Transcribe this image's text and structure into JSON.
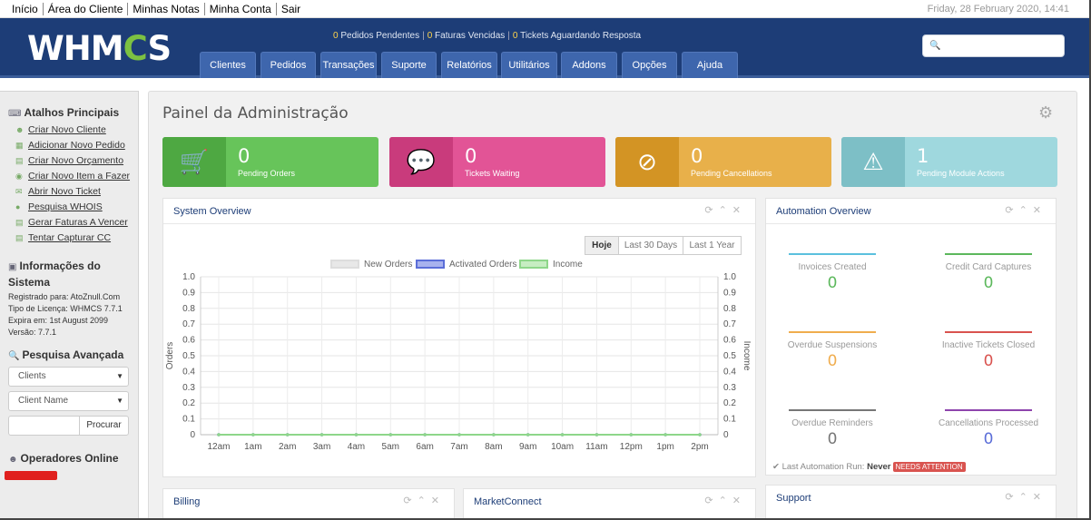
{
  "topbar": {
    "links": [
      "Início",
      "Área do Cliente",
      "Minhas Notas",
      "Minha Conta",
      "Sair"
    ],
    "date": "Friday, 28 February 2020, 14:41"
  },
  "header": {
    "logo_text": "WHMCS",
    "stats": [
      {
        "count": "0",
        "label": "Pedidos Pendentes"
      },
      {
        "count": "0",
        "label": "Faturas Vencidas"
      },
      {
        "count": "0",
        "label": "Tickets Aguardando Resposta"
      }
    ],
    "search": {
      "placeholder": "",
      "icon": "search-icon"
    },
    "nav": [
      "Clientes",
      "Pedidos",
      "Transações",
      "Suporte",
      "Relatórios",
      "Utilitários",
      "Addons",
      "Opções",
      "Ajuda"
    ]
  },
  "sidebar": {
    "shortcuts": {
      "title": "Atalhos Principais",
      "items": [
        {
          "label": "Criar Novo Cliente",
          "icon": "add-user-icon"
        },
        {
          "label": "Adicionar Novo Pedido",
          "icon": "add-order-icon"
        },
        {
          "label": "Criar Novo Orçamento",
          "icon": "quote-icon"
        },
        {
          "label": "Criar Novo Item a Fazer",
          "icon": "todo-icon"
        },
        {
          "label": "Abrir Novo Ticket",
          "icon": "ticket-icon"
        },
        {
          "label": "Pesquisa WHOIS",
          "icon": "globe-icon"
        },
        {
          "label": "Gerar Faturas A Vencer",
          "icon": "invoice-icon"
        },
        {
          "label": "Tentar Capturar CC",
          "icon": "credit-card-icon"
        }
      ]
    },
    "system_info": {
      "title": "Informações do Sistema",
      "lines": [
        "Registrado para: AtoZnull.Com",
        "Tipo de Licença: WHMCS 7.7.1",
        "Expira em: 1st August 2099",
        "Versão: 7.7.1"
      ]
    },
    "advanced_search": {
      "title": "Pesquisa Avançada",
      "type_select": "Clients",
      "field_select": "Client Name",
      "input_value": "",
      "button": "Procurar"
    },
    "operators": {
      "title": "Operadores Online"
    }
  },
  "main": {
    "title": "Painel da Administração",
    "tiles": [
      {
        "value": "0",
        "label": "Pending Orders",
        "icon": "cart-icon",
        "color": "#5cb85c"
      },
      {
        "value": "0",
        "label": "Tickets Waiting",
        "icon": "chat-bubble-icon",
        "color": "#de4d8c"
      },
      {
        "value": "0",
        "label": "Pending Cancellations",
        "icon": "ban-icon",
        "color": "#eaa73b"
      },
      {
        "value": "1",
        "label": "Pending Module Actions",
        "icon": "warning-icon",
        "color": "#8fd3d9"
      }
    ],
    "system_overview": {
      "title": "System Overview",
      "ranges": [
        "Hoje",
        "Last 30 Days",
        "Last 1 Year"
      ],
      "active_range": "Hoje"
    },
    "automation": {
      "title": "Automation Overview",
      "items": [
        {
          "label": "Invoices Created",
          "value": "0",
          "color": "#5bc0de"
        },
        {
          "label": "Credit Card Captures",
          "value": "0",
          "color": "#5cb85c"
        },
        {
          "label": "Overdue Suspensions",
          "value": "0",
          "color": "#f0ad4e"
        },
        {
          "label": "Inactive Tickets Closed",
          "value": "0",
          "color": "#d9534f"
        },
        {
          "label": "Overdue Reminders",
          "value": "0",
          "color": "#777777"
        },
        {
          "label": "Cancellations Processed",
          "value": "0",
          "color": "#8e44ad"
        }
      ],
      "last_run_label": "Last Automation Run:",
      "last_run_value": "Never",
      "badge": "NEEDS ATTENTION"
    },
    "billing": {
      "title": "Billing"
    },
    "marketconnect": {
      "title": "MarketConnect"
    },
    "support": {
      "title": "Support"
    }
  },
  "chart_data": {
    "type": "line",
    "x": [
      "12am",
      "1am",
      "2am",
      "3am",
      "4am",
      "5am",
      "6am",
      "7am",
      "8am",
      "9am",
      "10am",
      "11am",
      "12pm",
      "1pm",
      "2pm"
    ],
    "series": [
      {
        "name": "New Orders",
        "axis": "left",
        "values": [
          0,
          0,
          0,
          0,
          0,
          0,
          0,
          0,
          0,
          0,
          0,
          0,
          0,
          0,
          0
        ],
        "color": "#dddddd"
      },
      {
        "name": "Activated Orders",
        "axis": "left",
        "values": [
          0,
          0,
          0,
          0,
          0,
          0,
          0,
          0,
          0,
          0,
          0,
          0,
          0,
          0,
          0
        ],
        "color": "#5b6ed8"
      },
      {
        "name": "Income",
        "axis": "right",
        "values": [
          0,
          0,
          0,
          0,
          0,
          0,
          0,
          0,
          0,
          0,
          0,
          0,
          0,
          0,
          0
        ],
        "color": "#8ed68a"
      }
    ],
    "ylabel": "Orders",
    "y2label": "Income",
    "ylim": [
      0,
      1.0
    ],
    "y2lim": [
      0,
      1.0
    ],
    "yticks": [
      "0",
      "0.1",
      "0.2",
      "0.3",
      "0.4",
      "0.5",
      "0.6",
      "0.7",
      "0.8",
      "0.9",
      "1.0"
    ],
    "grid": true,
    "legend": "top-center"
  }
}
